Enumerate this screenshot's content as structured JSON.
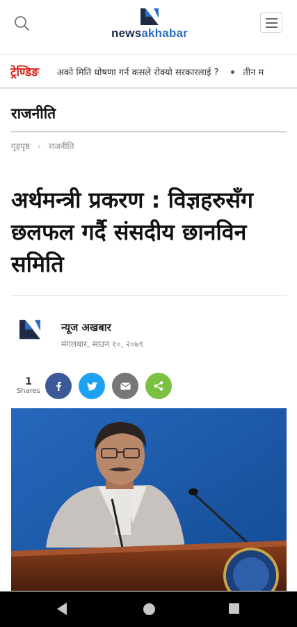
{
  "header": {
    "logo": {
      "prefix": "news",
      "accent": "akhabar",
      "mark_color_dark": "#1f2a44",
      "mark_color_light": "#2d6fc4"
    },
    "search_icon": "search-icon",
    "menu_icon": "hamburger-menu-icon"
  },
  "trending": {
    "label": "ट्रेण्डिङ",
    "items": [
      "अको मिति घोषणा गर्न कसले रोक्यो सरकारलाई ?",
      "तीन म"
    ]
  },
  "category": {
    "title": "राजनीति"
  },
  "breadcrumb": {
    "home": "गृहपृष्ठ",
    "separator": "›",
    "current": "राजनीति"
  },
  "article": {
    "title": "अर्थमन्त्री प्रकरण : विज्ञहरुसँग छलफल गर्दै संसदीय छानविन समिति",
    "author": "न्यूज अखबार",
    "date": "मंगलबार, साउन १०, २०७९"
  },
  "share": {
    "count": "1",
    "count_label": "Shares",
    "buttons": [
      {
        "name": "facebook",
        "icon": "facebook-icon",
        "color": "#3b5998"
      },
      {
        "name": "twitter",
        "icon": "twitter-icon",
        "color": "#1da1f2"
      },
      {
        "name": "email",
        "icon": "email-icon",
        "color": "#777777"
      },
      {
        "name": "share",
        "icon": "share-icon",
        "color": "#7ac142"
      }
    ]
  },
  "colors": {
    "accent_red": "#d9251d",
    "photo_background": "#1b5fb0"
  }
}
